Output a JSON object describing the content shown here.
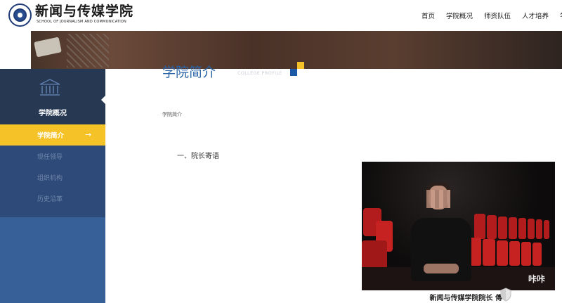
{
  "header": {
    "logo_cn": "新闻与传媒学院",
    "logo_en": "SCHOOL OF JOURNALISM AND COMMUNICATION",
    "nav": [
      "首页",
      "学院概况",
      "师资队伍",
      "人才培养",
      "学"
    ]
  },
  "sidebar": {
    "title": "学院概况",
    "active_item": "学院简介",
    "items": [
      "现任领导",
      "组织机构",
      "历史沿革"
    ]
  },
  "main": {
    "title": "学院简介",
    "subtitle": "COLLEGE PROFILE",
    "breadcrumb": "学院简介",
    "section_heading": "一、院长寄语"
  },
  "video": {
    "watermark": "咔咔",
    "caption": "新闻与传媒学院院长 傅"
  },
  "colors": {
    "accent_blue": "#2a64a6",
    "sidebar_dark": "#263852",
    "sidebar_mid": "#2d4a78",
    "sidebar_light": "#375f98",
    "active_yellow": "#f5c227"
  }
}
